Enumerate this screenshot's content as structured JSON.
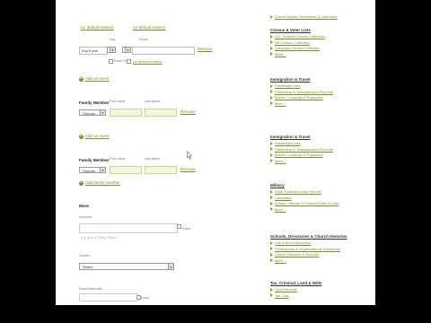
{
  "form": {
    "date_links": [
      "(or default entries)",
      "(or default entries)"
    ],
    "date_row1_sub": [
      "Day",
      "Month"
    ],
    "date_row1_value": "Any Event",
    "date_row1_select": "",
    "date_row2_sub": [
      "Exact Year"
    ],
    "date_row2_select": "",
    "date_row2_link": "(or default entries)",
    "remove_1": "Remove",
    "add_event_1": "Add an event",
    "family_label_1": "Family Member",
    "first_name_1": "First Name",
    "last_name_1": "Last Name",
    "choose_1": "Choose...",
    "remove_2": "Remove",
    "add_event_2": "Add an event",
    "family_label_2": "Family Member",
    "first_name_2": "First Name",
    "last_name_2": "Last Name",
    "choose_2": "Choose...",
    "remove_3": "Remove",
    "add_family": "Add family member",
    "more_heading": "More",
    "keyword_label": "Keyword",
    "keyword_placeholder": "e.g. pilot or Flying Tigers",
    "exact_label": "Exact",
    "gender_label": "Gender",
    "gender_value": "Select",
    "race_label": "Race/Nationality",
    "exact_label_2": "Exact"
  },
  "sidebar": {
    "sections": [
      {
        "heading": "",
        "links": [
          "Church Books, Directories & Calendars"
        ]
      },
      {
        "heading": "Census & Voter Lists",
        "links": [
          "U.S. Federal Census Collection",
          "UK Census Collection",
          "Canadian Census Collection",
          "More..."
        ]
      },
      {
        "heading": "Immigration & Travel",
        "links": [
          "Passenger Lists",
          "Citizenship & Naturalization Records",
          "Border Crossings & Passports",
          "More..."
        ]
      },
      {
        "heading": "Immigration & Travel",
        "links": [
          "Passenger Lists",
          "Citizenship & Naturalization Records",
          "Border Crossings & Passports",
          "More..."
        ]
      },
      {
        "heading": "Military",
        "links": [
          "Draft, Enlistment and Service",
          "Casualties",
          "Soldier, Veteran & Prisoner Rolls & Lists",
          "More..."
        ]
      },
      {
        "heading": "Schools, Directories & Church Histories",
        "links": [
          "City & Area Directories",
          "Professional & Organizational Directories",
          "Church Histories & Records",
          "More..."
        ]
      },
      {
        "heading": "Tax, Criminal, Land & Wills",
        "links": [
          "Land Records",
          "Tax Lists"
        ]
      }
    ]
  },
  "colors": {
    "link": "#7d8f2b",
    "highlight_input": "#f5f7dc",
    "frame": "#000000",
    "page": "#ffffff"
  },
  "icons": [
    "plus-icon",
    "triangle-bullet-icon",
    "dropdown-caret-icon",
    "mouse-cursor-icon"
  ]
}
